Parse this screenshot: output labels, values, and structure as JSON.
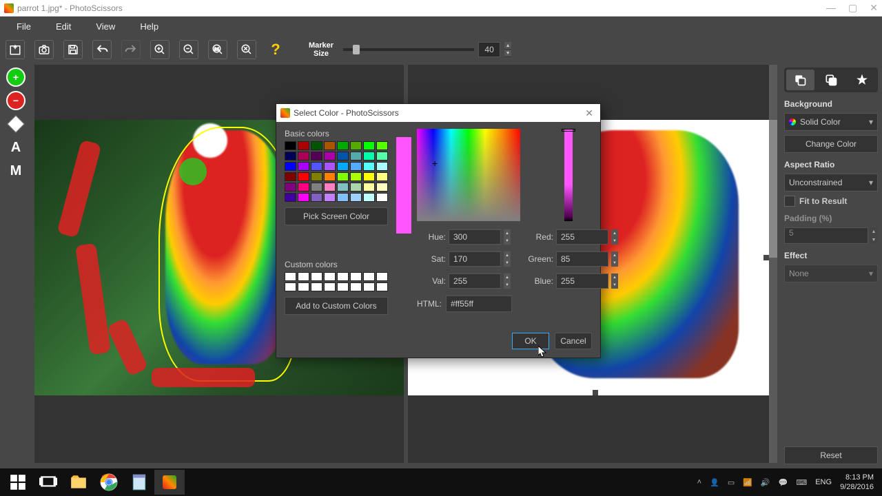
{
  "window": {
    "title": "parrot 1.jpg* - PhotoScissors"
  },
  "menu": {
    "file": "File",
    "edit": "Edit",
    "view": "View",
    "help": "Help"
  },
  "toolbar": {
    "marker_label_l1": "Marker",
    "marker_label_l2": "Size",
    "marker_value": "40"
  },
  "right_panel": {
    "background_label": "Background",
    "bg_mode": "Solid Color",
    "change_color": "Change Color",
    "aspect_label": "Aspect Ratio",
    "aspect_value": "Unconstrained",
    "fit_label": "Fit to Result",
    "padding_label": "Padding (%)",
    "padding_value": "5",
    "effect_label": "Effect",
    "effect_value": "None",
    "reset": "Reset"
  },
  "color_dialog": {
    "title": "Select Color - PhotoScissors",
    "basic_label": "Basic colors",
    "pick_screen": "Pick Screen Color",
    "custom_label": "Custom colors",
    "add_custom": "Add to Custom Colors",
    "hue_label": "Hue:",
    "hue_val": "300",
    "sat_label": "Sat:",
    "sat_val": "170",
    "val_label": "Val:",
    "val_val": "255",
    "red_label": "Red:",
    "red_val": "255",
    "green_label": "Green:",
    "green_val": "85",
    "blue_label": "Blue:",
    "blue_val": "255",
    "html_label": "HTML:",
    "html_val": "#ff55ff",
    "ok": "OK",
    "cancel": "Cancel",
    "basic_colors": [
      "#000000",
      "#aa0000",
      "#005500",
      "#aa5500",
      "#00aa00",
      "#55aa00",
      "#00ff00",
      "#55ff00",
      "#000055",
      "#aa0055",
      "#550055",
      "#aa00aa",
      "#0055aa",
      "#55aaaa",
      "#00ffaa",
      "#55ffaa",
      "#0000ff",
      "#aa00ff",
      "#5555ff",
      "#aa55ff",
      "#00aaff",
      "#55aaff",
      "#55ffff",
      "#aaffff",
      "#800000",
      "#ff0000",
      "#808000",
      "#ff8000",
      "#80ff00",
      "#aaff00",
      "#ffff00",
      "#ffff80",
      "#800080",
      "#ff0080",
      "#808080",
      "#ff80c0",
      "#80c0c0",
      "#aad4aa",
      "#ffffa0",
      "#ffffc0",
      "#4000a0",
      "#ff00ff",
      "#8060c0",
      "#c080ff",
      "#80c0ff",
      "#a0d0ff",
      "#c0ffff",
      "#ffffff"
    ]
  },
  "taskbar": {
    "lang": "ENG",
    "time": "8:13 PM",
    "date": "9/28/2016"
  }
}
